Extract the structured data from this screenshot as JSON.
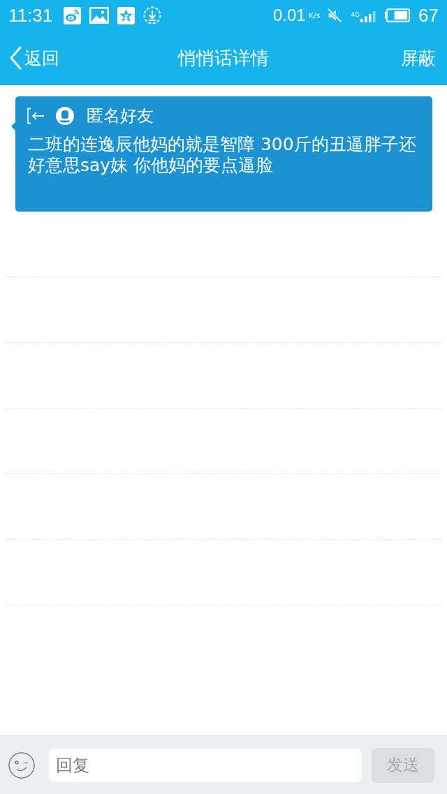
{
  "status_bar": {
    "time": "11:31",
    "network_speed": "0.01",
    "speed_unit": "K/s",
    "network_type": "4G",
    "battery": "67"
  },
  "nav_bar": {
    "back_label": "返回",
    "title": "悄悄话详情",
    "action": "屏蔽"
  },
  "message": {
    "sender": "匿名好友",
    "text": "二班的连逸辰他妈的就是智障 300斤的丑逼胖子还好意思say妹 你他妈的要点逼脸"
  },
  "reply_bar": {
    "placeholder": "回复",
    "send": {
      "label": "发送",
      "disabled": true
    }
  }
}
